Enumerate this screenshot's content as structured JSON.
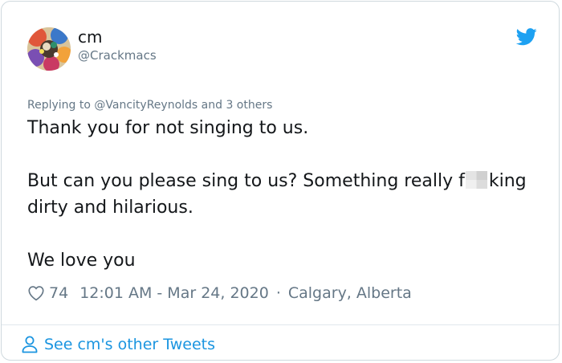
{
  "author": {
    "name": "cm",
    "handle": "@Crackmacs"
  },
  "reply": {
    "prefix": "Replying to",
    "mention": "@VancityReynolds",
    "suffix": "and 3 others"
  },
  "tweet": {
    "line1": "Thank you for not singing to us.",
    "line2a": "But can you please sing to us? Something really f",
    "line2b": "king dirty and hilarious.",
    "line3": "We love you"
  },
  "meta": {
    "likes": "74",
    "timestamp": "12:01 AM - Mar 24, 2020",
    "separator": "·",
    "location": "Calgary, Alberta"
  },
  "footer": {
    "link_label": "See cm's other Tweets"
  },
  "icons": {
    "logo": "twitter-bird-icon",
    "like": "heart-icon",
    "profile": "person-icon"
  },
  "colors": {
    "twitter_blue": "#1da1f2",
    "link_blue": "#1b95e0",
    "secondary_text": "#657786",
    "primary_text": "#14171a"
  }
}
